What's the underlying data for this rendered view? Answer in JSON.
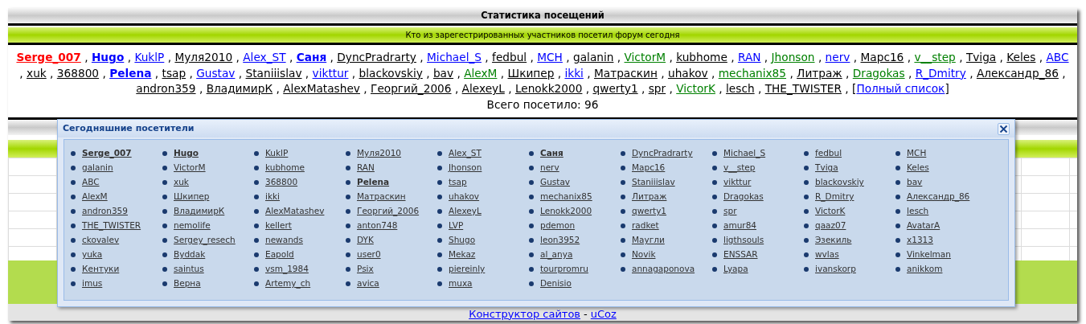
{
  "header": {
    "title": "Статистика посещений"
  },
  "subheader": {
    "text": "Кто из зарегестрированных участников посетил форум сегодня"
  },
  "visitors": {
    "separator": ",",
    "items": [
      {
        "name": "Serge_007",
        "color": "#ff0000",
        "bold": true
      },
      {
        "name": "Hugo",
        "color": "#0000ff",
        "bold": true
      },
      {
        "name": "KuklP",
        "color": "#0000ff",
        "bold": false
      },
      {
        "name": "Муля2010",
        "color": "#000000",
        "bold": false
      },
      {
        "name": "Alex_ST",
        "color": "#0000ff",
        "bold": false
      },
      {
        "name": "Саня",
        "color": "#0000ff",
        "bold": true
      },
      {
        "name": "DyncPradrarty",
        "color": "#000000",
        "bold": false
      },
      {
        "name": "Michael_S",
        "color": "#0000ff",
        "bold": false
      },
      {
        "name": "fedbul",
        "color": "#000000",
        "bold": false
      },
      {
        "name": "MCH",
        "color": "#0000ff",
        "bold": false
      },
      {
        "name": "galanin",
        "color": "#000000",
        "bold": false
      },
      {
        "name": "VictorM",
        "color": "#008000",
        "bold": false
      },
      {
        "name": "kubhome",
        "color": "#000000",
        "bold": false
      },
      {
        "name": "RAN",
        "color": "#0000ff",
        "bold": false
      },
      {
        "name": "Jhonson",
        "color": "#008000",
        "bold": false
      },
      {
        "name": "nerv",
        "color": "#0000ff",
        "bold": false
      },
      {
        "name": "Марс16",
        "color": "#000000",
        "bold": false
      },
      {
        "name": "v__step",
        "color": "#008000",
        "bold": false
      },
      {
        "name": "Tviga",
        "color": "#000000",
        "bold": false
      },
      {
        "name": "Keles",
        "color": "#000000",
        "bold": false
      },
      {
        "name": "ABC",
        "color": "#0000ff",
        "bold": false
      },
      {
        "name": "xuk",
        "color": "#000000",
        "bold": false
      },
      {
        "name": "368800",
        "color": "#000000",
        "bold": false
      },
      {
        "name": "Pelena",
        "color": "#0000ff",
        "bold": true
      },
      {
        "name": "tsap",
        "color": "#000000",
        "bold": false
      },
      {
        "name": "Gustav",
        "color": "#0000ff",
        "bold": false
      },
      {
        "name": "Staniiislav",
        "color": "#000000",
        "bold": false
      },
      {
        "name": "vikttur",
        "color": "#0000ff",
        "bold": false
      },
      {
        "name": "blackovskiy",
        "color": "#000000",
        "bold": false
      },
      {
        "name": "bav",
        "color": "#000000",
        "bold": false
      },
      {
        "name": "AlexM",
        "color": "#008000",
        "bold": false
      },
      {
        "name": "Шкипер",
        "color": "#000000",
        "bold": false
      },
      {
        "name": "ikki",
        "color": "#0000ff",
        "bold": false
      },
      {
        "name": "Матраскин",
        "color": "#000000",
        "bold": false
      },
      {
        "name": "uhakov",
        "color": "#000000",
        "bold": false
      },
      {
        "name": "mechanix85",
        "color": "#008000",
        "bold": false
      },
      {
        "name": "Литраж",
        "color": "#000000",
        "bold": false
      },
      {
        "name": "Dragokas",
        "color": "#008000",
        "bold": false
      },
      {
        "name": "R_Dmitry",
        "color": "#0000ff",
        "bold": false
      },
      {
        "name": "Александр_86",
        "color": "#000000",
        "bold": false
      },
      {
        "name": "andron359",
        "color": "#000000",
        "bold": false
      },
      {
        "name": "ВладимирК",
        "color": "#000000",
        "bold": false
      },
      {
        "name": "AlexMatashev",
        "color": "#000000",
        "bold": false
      },
      {
        "name": "Георгий_2006",
        "color": "#000000",
        "bold": false
      },
      {
        "name": "AlexeyL",
        "color": "#000000",
        "bold": false
      },
      {
        "name": "Lenokk2000",
        "color": "#000000",
        "bold": false
      },
      {
        "name": "qwerty1",
        "color": "#000000",
        "bold": false
      },
      {
        "name": "spr",
        "color": "#000000",
        "bold": false
      },
      {
        "name": "VictorK",
        "color": "#008000",
        "bold": false
      },
      {
        "name": "lesch",
        "color": "#000000",
        "bold": false
      },
      {
        "name": "THE_TWISTER",
        "color": "#000000",
        "bold": false
      }
    ],
    "full_list": {
      "open": "[",
      "label": "Полный список",
      "close": "]"
    },
    "total": "Всего посетило: 96"
  },
  "popup": {
    "title": "Сегодняшние посетители",
    "items": [
      {
        "name": "Serge_007",
        "bold": true
      },
      {
        "name": "Hugo",
        "bold": true
      },
      {
        "name": "KuklP",
        "bold": false
      },
      {
        "name": "Муля2010",
        "bold": false
      },
      {
        "name": "Alex_ST",
        "bold": false
      },
      {
        "name": "Саня",
        "bold": true
      },
      {
        "name": "DyncPradrarty",
        "bold": false
      },
      {
        "name": "Michael_S",
        "bold": false
      },
      {
        "name": "fedbul",
        "bold": false
      },
      {
        "name": "MCH",
        "bold": false
      },
      {
        "name": "galanin",
        "bold": false
      },
      {
        "name": "VictorM",
        "bold": false
      },
      {
        "name": "kubhome",
        "bold": false
      },
      {
        "name": "RAN",
        "bold": false
      },
      {
        "name": "Jhonson",
        "bold": false
      },
      {
        "name": "nerv",
        "bold": false
      },
      {
        "name": "Марс16",
        "bold": false
      },
      {
        "name": "v__step",
        "bold": false
      },
      {
        "name": "Tviga",
        "bold": false
      },
      {
        "name": "Keles",
        "bold": false
      },
      {
        "name": "ABC",
        "bold": false
      },
      {
        "name": "xuk",
        "bold": false
      },
      {
        "name": "368800",
        "bold": false
      },
      {
        "name": "Pelena",
        "bold": true
      },
      {
        "name": "tsap",
        "bold": false
      },
      {
        "name": "Gustav",
        "bold": false
      },
      {
        "name": "Staniiislav",
        "bold": false
      },
      {
        "name": "vikttur",
        "bold": false
      },
      {
        "name": "blackovskiy",
        "bold": false
      },
      {
        "name": "bav",
        "bold": false
      },
      {
        "name": "AlexM",
        "bold": false
      },
      {
        "name": "Шкипер",
        "bold": false
      },
      {
        "name": "ikki",
        "bold": false
      },
      {
        "name": "Матраскин",
        "bold": false
      },
      {
        "name": "uhakov",
        "bold": false
      },
      {
        "name": "mechanix85",
        "bold": false
      },
      {
        "name": "Литраж",
        "bold": false
      },
      {
        "name": "Dragokas",
        "bold": false
      },
      {
        "name": "R_Dmitry",
        "bold": false
      },
      {
        "name": "Александр_86",
        "bold": false
      },
      {
        "name": "andron359",
        "bold": false
      },
      {
        "name": "ВладимирК",
        "bold": false
      },
      {
        "name": "AlexMatashev",
        "bold": false
      },
      {
        "name": "Георгий_2006",
        "bold": false
      },
      {
        "name": "AlexeyL",
        "bold": false
      },
      {
        "name": "Lenokk2000",
        "bold": false
      },
      {
        "name": "qwerty1",
        "bold": false
      },
      {
        "name": "spr",
        "bold": false
      },
      {
        "name": "VictorK",
        "bold": false
      },
      {
        "name": "lesch",
        "bold": false
      },
      {
        "name": "THE_TWISTER",
        "bold": false
      },
      {
        "name": "nemolife",
        "bold": false
      },
      {
        "name": "kellert",
        "bold": false
      },
      {
        "name": "anton748",
        "bold": false
      },
      {
        "name": "LVP",
        "bold": false
      },
      {
        "name": "pdemon",
        "bold": false
      },
      {
        "name": "radket",
        "bold": false
      },
      {
        "name": "amur84",
        "bold": false
      },
      {
        "name": "qaaz07",
        "bold": false
      },
      {
        "name": "AvatarA",
        "bold": false
      },
      {
        "name": "ckovalev",
        "bold": false
      },
      {
        "name": "Sergey_resech",
        "bold": false
      },
      {
        "name": "newands",
        "bold": false
      },
      {
        "name": "DYK",
        "bold": false
      },
      {
        "name": "Shugo",
        "bold": false
      },
      {
        "name": "leon3952",
        "bold": false
      },
      {
        "name": "Маугли",
        "bold": false
      },
      {
        "name": "ligthsouls",
        "bold": false
      },
      {
        "name": "Эзекиль",
        "bold": false
      },
      {
        "name": "x1313",
        "bold": false
      },
      {
        "name": "yuka",
        "bold": false
      },
      {
        "name": "Byddak",
        "bold": false
      },
      {
        "name": "Eapold",
        "bold": false
      },
      {
        "name": "user0",
        "bold": false
      },
      {
        "name": "Mekaz",
        "bold": false
      },
      {
        "name": "al_anya",
        "bold": false
      },
      {
        "name": "Novik",
        "bold": false
      },
      {
        "name": "ENSSAR",
        "bold": false
      },
      {
        "name": "wvlas",
        "bold": false
      },
      {
        "name": "Vinkelman",
        "bold": false
      },
      {
        "name": "Кентуки",
        "bold": false
      },
      {
        "name": "saintus",
        "bold": false
      },
      {
        "name": "vsm_1984",
        "bold": false
      },
      {
        "name": "Psix",
        "bold": false
      },
      {
        "name": "piereinly",
        "bold": false
      },
      {
        "name": "tourpromru",
        "bold": false
      },
      {
        "name": "annagaponova",
        "bold": false
      },
      {
        "name": "Lyapa",
        "bold": false
      },
      {
        "name": "ivanskorp",
        "bold": false
      },
      {
        "name": "anikkom",
        "bold": false
      },
      {
        "name": "imus",
        "bold": false
      },
      {
        "name": "Верна",
        "bold": false
      },
      {
        "name": "Artemy_ch",
        "bold": false
      },
      {
        "name": "avica",
        "bold": false
      },
      {
        "name": "muxa",
        "bold": false
      },
      {
        "name": "Denisio",
        "bold": false
      }
    ]
  },
  "footer": {
    "links": [
      "Конструктор сайтов",
      "uCoz"
    ],
    "separator": "-"
  }
}
